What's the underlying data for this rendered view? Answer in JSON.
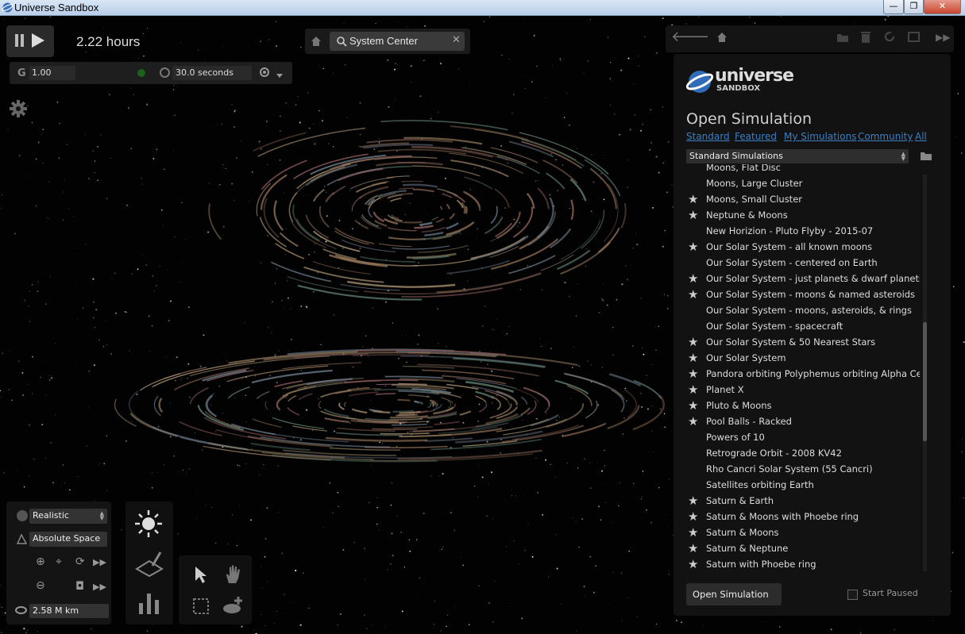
{
  "window": {
    "title": "Universe Sandbox",
    "min_glyph": "—",
    "max_glyph": "❐",
    "close_glyph": "✕"
  },
  "sim": {
    "elapsed": "2.22 hours",
    "gravity_label": "G",
    "gravity_value": "1.00",
    "time_step": "30.0 seconds"
  },
  "search": {
    "value": "System Center",
    "clear_glyph": "✕"
  },
  "view": {
    "mode": "Realistic",
    "frame": "Absolute Space",
    "distance": "2.58 M km"
  },
  "panel": {
    "logo_word": "universe",
    "logo_sub": "SANDBOX",
    "title": "Open Simulation",
    "categories": [
      "Standard",
      "Featured",
      "My Simulations",
      "Community",
      "All"
    ],
    "dropdown": "Standard Simulations",
    "open_button": "Open Simulation",
    "start_paused": "Start Paused",
    "items": [
      {
        "name": "Moons, Flat Disc",
        "star": false
      },
      {
        "name": "Moons, Large Cluster",
        "star": false
      },
      {
        "name": "Moons, Small Cluster",
        "star": true
      },
      {
        "name": "Neptune & Moons",
        "star": true
      },
      {
        "name": "New Horizion - Pluto Flyby - 2015-07",
        "star": false
      },
      {
        "name": "Our Solar System - all known moons",
        "star": true
      },
      {
        "name": "Our Solar System - centered on Earth",
        "star": false
      },
      {
        "name": "Our Solar System - just planets & dwarf planets",
        "star": true
      },
      {
        "name": "Our Solar System - moons & named asteroids",
        "star": true
      },
      {
        "name": "Our Solar System - moons, asteroids, & rings",
        "star": false
      },
      {
        "name": "Our Solar System - spacecraft",
        "star": false
      },
      {
        "name": "Our Solar System & 50 Nearest Stars",
        "star": true
      },
      {
        "name": "Our Solar System",
        "star": true
      },
      {
        "name": "Pandora orbiting Polyphemus orbiting Alpha Cen",
        "star": true
      },
      {
        "name": "Planet X",
        "star": true
      },
      {
        "name": "Pluto & Moons",
        "star": true
      },
      {
        "name": "Pool Balls - Racked",
        "star": true
      },
      {
        "name": "Powers of 10",
        "star": false
      },
      {
        "name": "Retrograde Orbit - 2008 KV42",
        "star": false
      },
      {
        "name": "Rho Cancri Solar System (55 Cancri)",
        "star": false
      },
      {
        "name": "Satellites orbiting Earth",
        "star": false
      },
      {
        "name": "Saturn & Earth",
        "star": true
      },
      {
        "name": "Saturn & Moons with Phoebe ring",
        "star": true
      },
      {
        "name": "Saturn & Moons",
        "star": true
      },
      {
        "name": "Saturn & Neptune",
        "star": true
      },
      {
        "name": "Saturn with Phoebe ring",
        "star": true
      }
    ],
    "star_glyph": "★"
  },
  "icons": {
    "back": "back-arrow-icon",
    "home": "home-icon",
    "forward": "fast-forward-icon"
  }
}
